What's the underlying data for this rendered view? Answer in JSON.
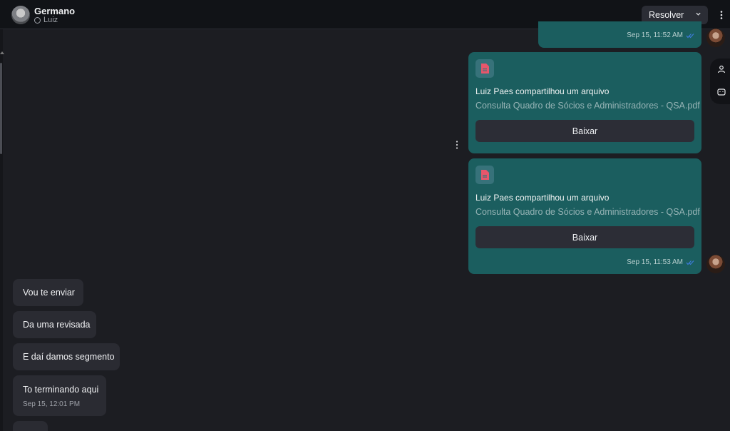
{
  "header": {
    "contact_name": "Germano",
    "contact_sub": "Luiz",
    "resolve_label": "Resolver"
  },
  "messages_out": [
    {
      "timestamp": "Sep 15, 11:52 AM"
    },
    {
      "file_title": "Luiz Paes compartilhou um arquivo",
      "file_name": "Consulta Quadro de Sócios e Administradores - QSA.pdf",
      "button": "Baixar"
    },
    {
      "file_title": "Luiz Paes compartilhou um arquivo",
      "file_name": "Consulta Quadro de Sócios e Administradores - QSA.pdf",
      "button": "Baixar",
      "timestamp": "Sep 15, 11:53 AM"
    }
  ],
  "messages_in": [
    {
      "text": "Vou te enviar"
    },
    {
      "text": "Da uma revisada"
    },
    {
      "text": "E daí damos segmento"
    },
    {
      "text": "To terminando aqui",
      "timestamp": "Sep 15, 12:01 PM"
    }
  ],
  "colors": {
    "background": "#1c1d22",
    "outgoing_bubble": "#1b5e5f",
    "incoming_bubble": "#2a2b32",
    "file_icon": "#e8566b",
    "read_tick": "#3d7bd9"
  },
  "icons": [
    "whatsapp-icon",
    "chevron-down-icon",
    "more-vertical-icon",
    "file-icon",
    "double-check-icon",
    "contact-icon",
    "message-square-icon"
  ]
}
